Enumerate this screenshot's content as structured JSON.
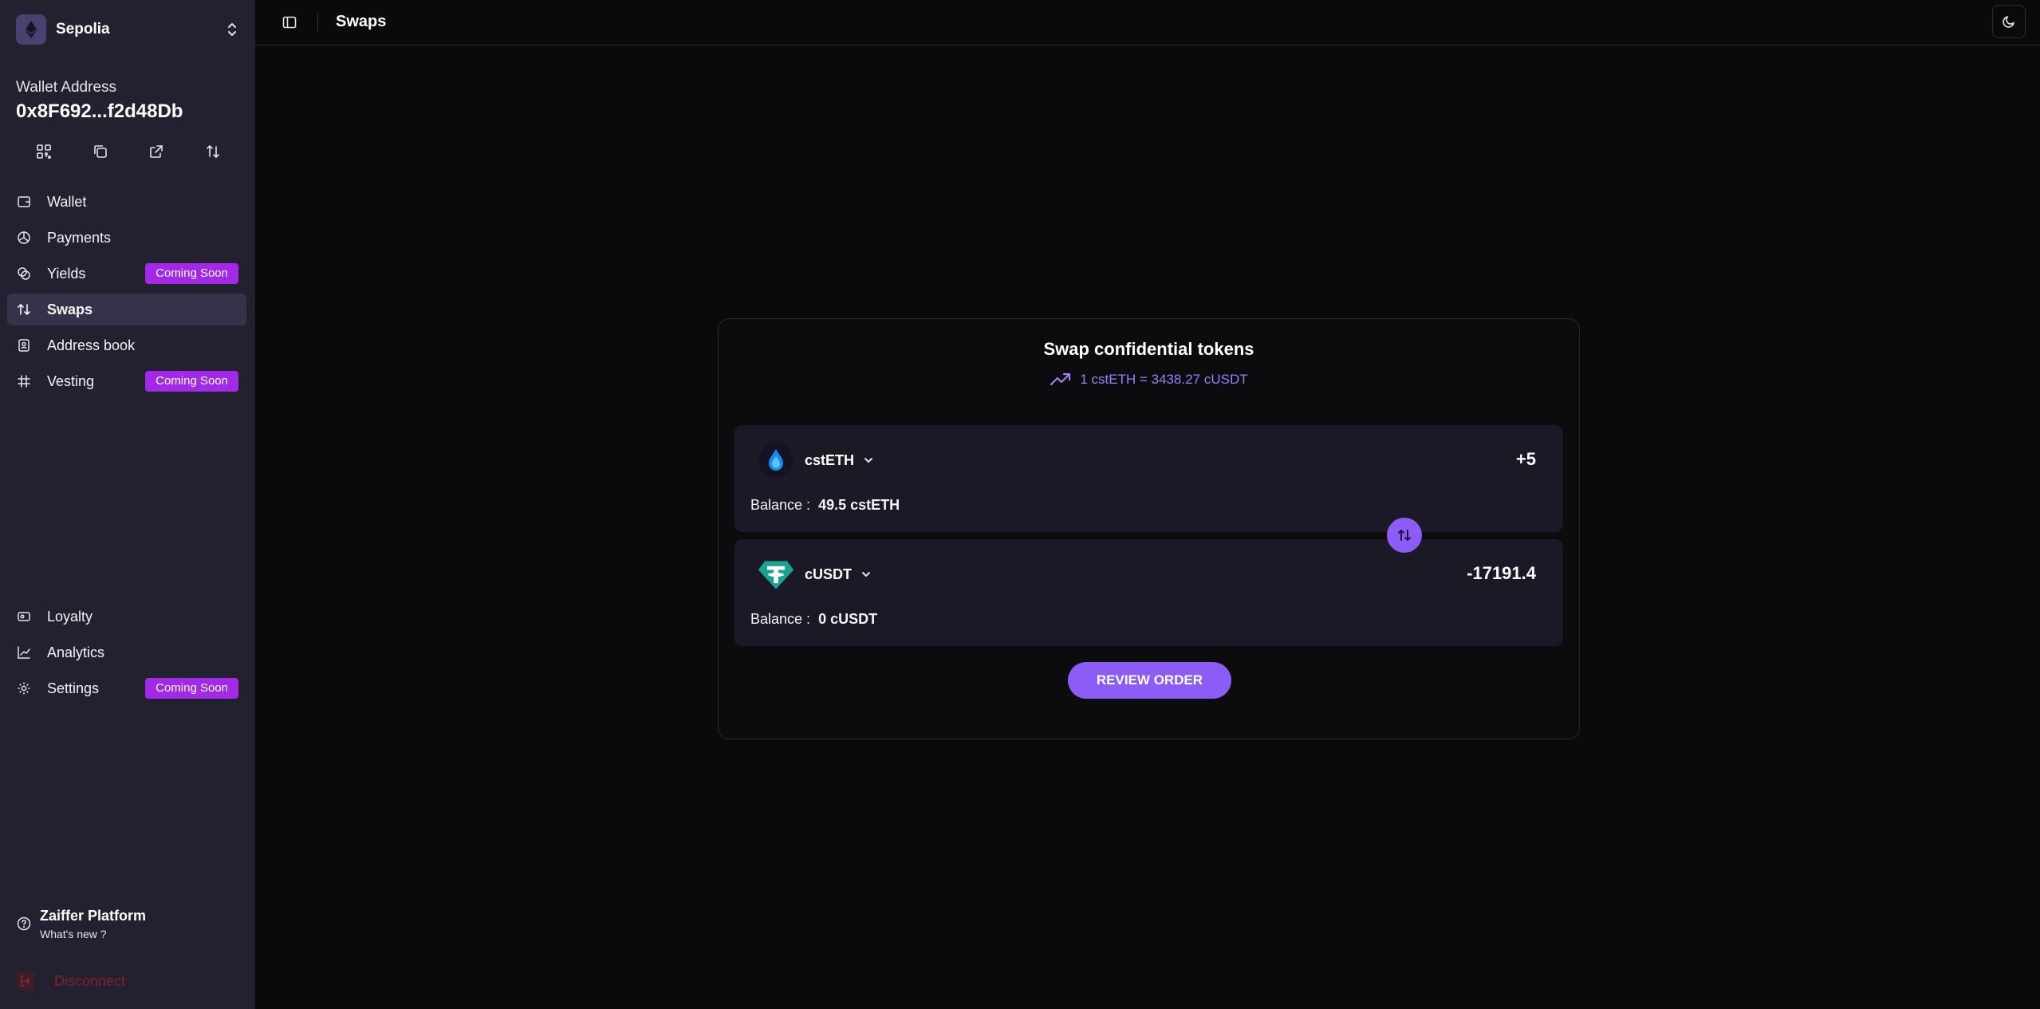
{
  "network": {
    "name": "Sepolia"
  },
  "wallet": {
    "label": "Wallet Address",
    "address": "0x8F692...f2d48Db"
  },
  "nav": {
    "items": [
      {
        "label": "Wallet",
        "icon": "wallet-icon"
      },
      {
        "label": "Payments",
        "icon": "payments-icon"
      },
      {
        "label": "Yields",
        "icon": "yields-icon",
        "badge": "Coming Soon"
      },
      {
        "label": "Swaps",
        "icon": "swap-icon",
        "active": true
      },
      {
        "label": "Address book",
        "icon": "address-book-icon"
      },
      {
        "label": "Vesting",
        "icon": "vesting-icon",
        "badge": "Coming Soon"
      }
    ],
    "bottom_items": [
      {
        "label": "Loyalty",
        "icon": "loyalty-icon"
      },
      {
        "label": "Analytics",
        "icon": "analytics-icon"
      },
      {
        "label": "Settings",
        "icon": "gear-icon",
        "badge": "Coming Soon"
      }
    ]
  },
  "help": {
    "title": "Zaiffer Platform",
    "subtitle": "What's new ?"
  },
  "disconnect": {
    "label": "Disconnect"
  },
  "header": {
    "title": "Swaps"
  },
  "swap": {
    "title": "Swap confidential tokens",
    "rate": "1 cstETH = 3438.27 cUSDT",
    "from": {
      "token": "cstETH",
      "amount": "+5",
      "balance_label": "Balance :",
      "balance": "49.5 cstETH"
    },
    "to": {
      "token": "cUSDT",
      "amount": "-17191.4",
      "balance_label": "Balance :",
      "balance": "0 cUSDT"
    },
    "review_label": "REVIEW ORDER"
  },
  "colors": {
    "accent": "#8b5cf6",
    "badge": "#a229e8",
    "sidebar": "#23202f",
    "background": "#0a0a0b"
  }
}
